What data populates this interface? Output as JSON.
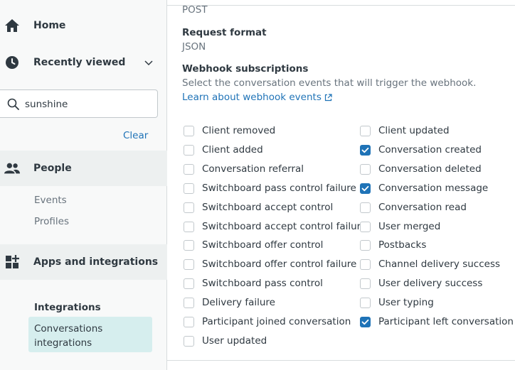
{
  "sidebar": {
    "home_label": "Home",
    "recent_label": "Recently viewed",
    "search_value": "sunshine",
    "clear_label": "Clear",
    "people_label": "People",
    "people_subitems": [
      "Events",
      "Profiles"
    ],
    "apps_label": "Apps and integrations",
    "integrations_heading": "Integrations",
    "conv_integrations_label": "Conversations integrations"
  },
  "main": {
    "method_value": "POST",
    "request_format_label": "Request format",
    "request_format_value": "JSON",
    "subscriptions_label": "Webhook subscriptions",
    "subscriptions_hint": "Select the conversation events that will trigger the webhook.",
    "learn_link": "Learn about webhook events",
    "left_events": [
      {
        "label": "Client removed",
        "checked": false
      },
      {
        "label": "Client added",
        "checked": false
      },
      {
        "label": "Conversation referral",
        "checked": false
      },
      {
        "label": "Switchboard pass control failure",
        "checked": false
      },
      {
        "label": "Switchboard accept control",
        "checked": false
      },
      {
        "label": "Switchboard accept control failure",
        "checked": false
      },
      {
        "label": "Switchboard offer control",
        "checked": false
      },
      {
        "label": "Switchboard offer control failure",
        "checked": false
      },
      {
        "label": "Switchboard pass control",
        "checked": false
      },
      {
        "label": "Delivery failure",
        "checked": false
      },
      {
        "label": "Participant joined conversation",
        "checked": false
      },
      {
        "label": "User updated",
        "checked": false
      }
    ],
    "right_events": [
      {
        "label": "Client updated",
        "checked": false
      },
      {
        "label": "Conversation created",
        "checked": true
      },
      {
        "label": "Conversation deleted",
        "checked": false
      },
      {
        "label": "Conversation message",
        "checked": true
      },
      {
        "label": "Conversation read",
        "checked": false
      },
      {
        "label": "User merged",
        "checked": false
      },
      {
        "label": "Postbacks",
        "checked": false
      },
      {
        "label": "Channel delivery success",
        "checked": false
      },
      {
        "label": "User delivery success",
        "checked": false
      },
      {
        "label": "User typing",
        "checked": false
      },
      {
        "label": "Participant left conversation",
        "checked": true
      }
    ]
  },
  "colors": {
    "accent": "#1f73b7",
    "selected_nav": "#d6eeee",
    "sidebar_bg": "#f8f9f9"
  }
}
